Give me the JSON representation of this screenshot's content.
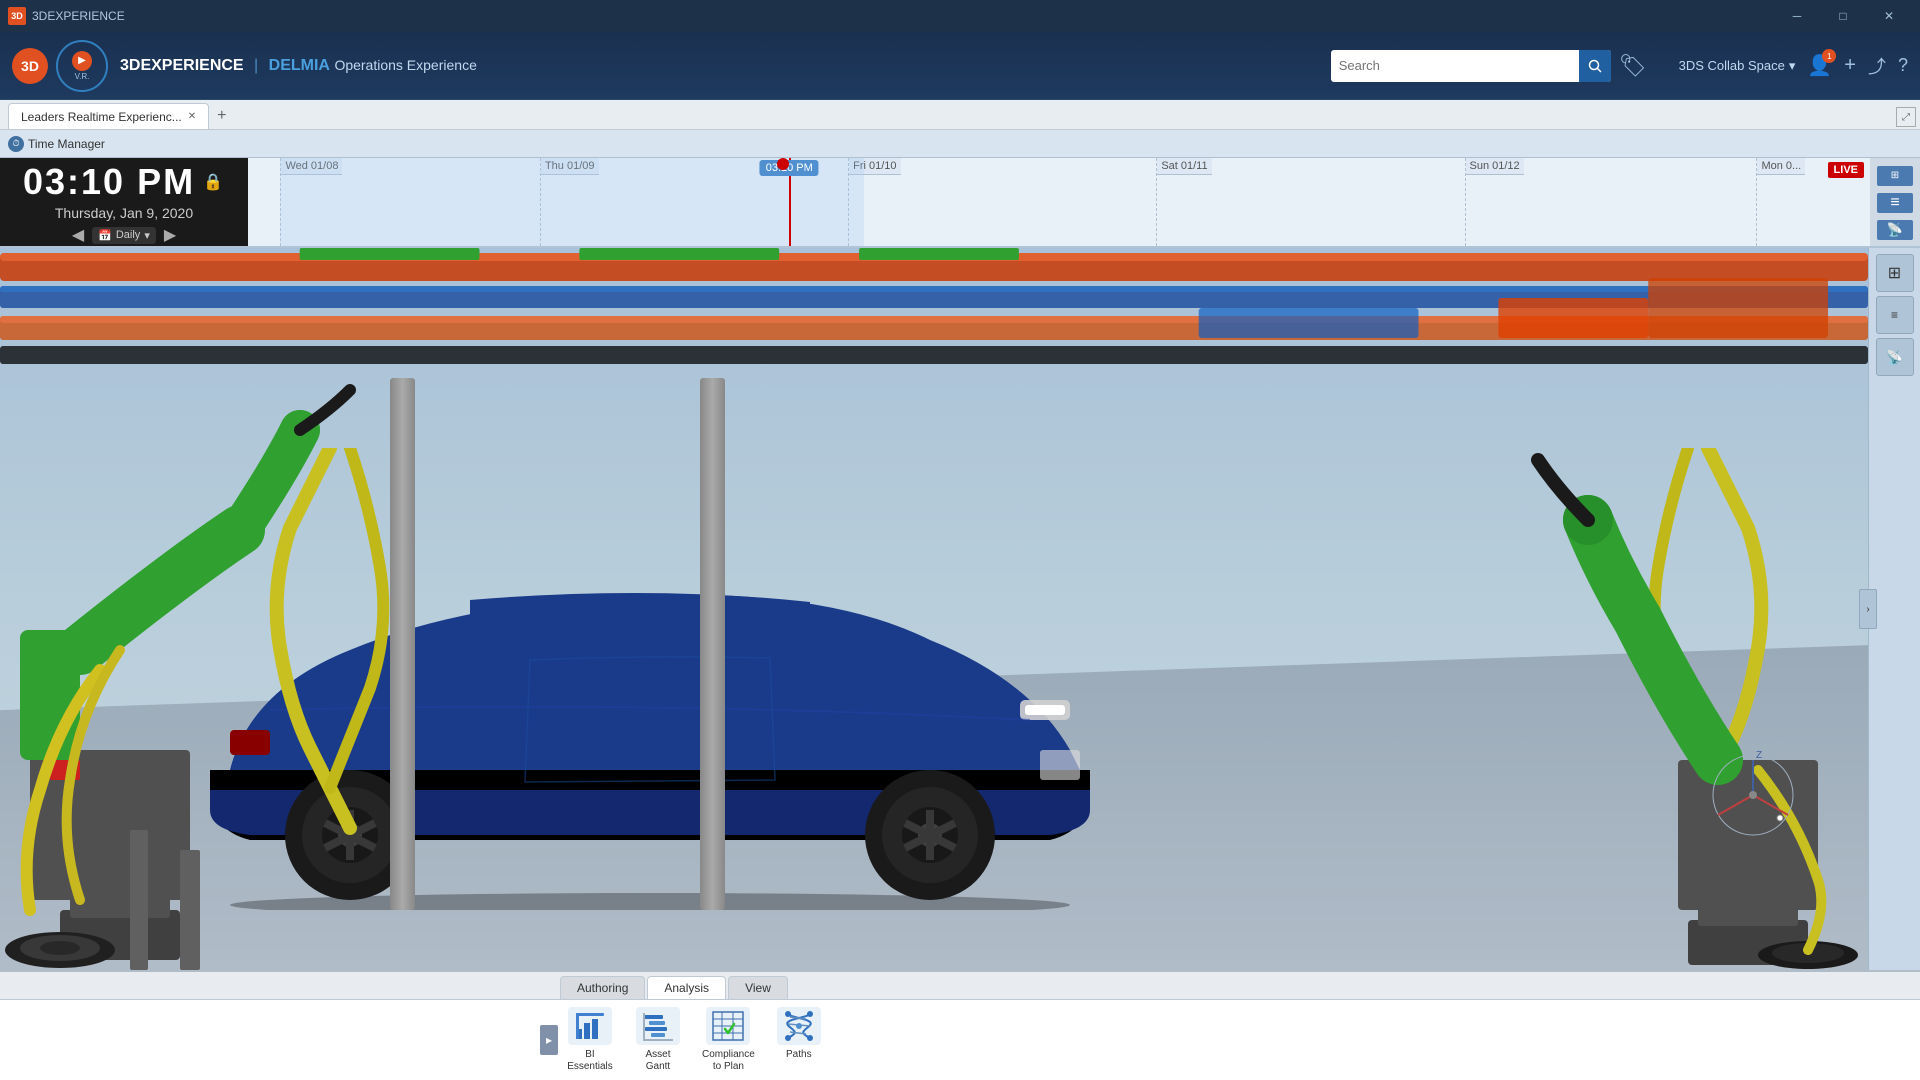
{
  "app": {
    "title": "3DEXPERIENCE",
    "brand": "3D",
    "logo_text": "3DEXPERIENCE",
    "brand_pipe": "|",
    "delmia": "DELMIA",
    "subtitle": "Operations Experience"
  },
  "header": {
    "search_placeholder": "Search",
    "collab_space": "3DS Collab Space",
    "collab_arrow": "▾"
  },
  "tabs": [
    {
      "label": "Leaders Realtime Experienc...",
      "active": true
    }
  ],
  "timemanager": {
    "label": "Time Manager"
  },
  "timeline": {
    "time": "03:10 PM",
    "date": "Thursday, Jan 9, 2020",
    "period": "Daily",
    "cursor_time": "03:10 PM",
    "live_label": "LIVE",
    "markers": [
      {
        "label": "Wed 01/08",
        "pos_pct": 5
      },
      {
        "label": "Thu 01/09",
        "pos_pct": 20
      },
      {
        "label": "Fri 01/10",
        "pos_pct": 38
      },
      {
        "label": "Sat 01/11",
        "pos_pct": 57
      },
      {
        "label": "Sun 01/12",
        "pos_pct": 76
      },
      {
        "label": "Mon 0...",
        "pos_pct": 94
      }
    ]
  },
  "toolbar": {
    "tabs": [
      "Authoring",
      "Analysis",
      "View"
    ],
    "active_tab": "Analysis",
    "tools": [
      {
        "id": "bi-essentials",
        "label": "BI\nEssentials",
        "line1": "BI",
        "line2": "Essentials"
      },
      {
        "id": "asset-gantt",
        "label": "Asset\nGantt",
        "line1": "Asset",
        "line2": "Gantt"
      },
      {
        "id": "compliance-to-plan",
        "label": "Compliance\nto Plan",
        "line1": "Compliance",
        "line2": "to Plan"
      },
      {
        "id": "paths",
        "label": "Paths",
        "line1": "Paths",
        "line2": ""
      }
    ]
  },
  "icons": {
    "search": "🔍",
    "tag": "🏷",
    "user": "👤",
    "plus": "+",
    "share": "⤴",
    "help": "?",
    "close": "✕",
    "minimize": "─",
    "maximize": "□",
    "lock": "🔒",
    "prev": "◀",
    "next": "▶",
    "expand": "▼",
    "calendar": "📅",
    "live": "LIVE",
    "chevron_down": "▾"
  },
  "window_controls": {
    "minimize": "─",
    "maximize": "□",
    "close": "✕"
  },
  "right_panel": {
    "buttons": [
      "≡",
      "📡",
      "⊞"
    ]
  }
}
